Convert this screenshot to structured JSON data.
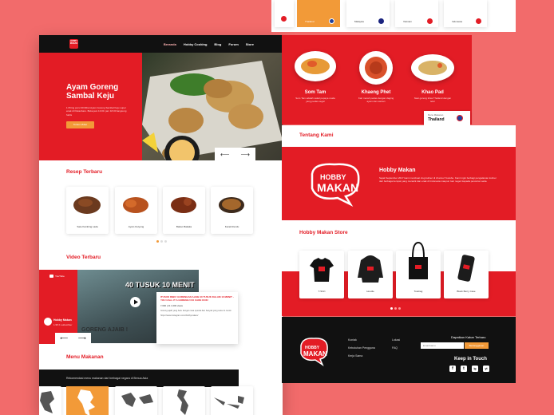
{
  "nav": {
    "logo": "HOBBY MAKAN",
    "links": [
      "Beranda",
      "Hobby Cooking",
      "Blog",
      "Forum",
      "Store"
    ]
  },
  "hero": {
    "title": "Ayam Goreng Sambal Keju",
    "description": "1 Piring porsi 30 Ribut Ayam Goreng Sambal Keju super enak di Pekanbaru. Buka jam 10.00. jam 18.00 langsung habis",
    "button": "Tonton Video",
    "prev": "⟵",
    "next": "⟶"
  },
  "recipes": {
    "title": "Resep Terbaru",
    "items": [
      {
        "name": "Sate Kambing Lada",
        "color": "#6b3a1f"
      },
      {
        "name": "Ayam Ketyung",
        "color": "#b8521e"
      },
      {
        "name": "Bakso Bakaka",
        "color": "#7a2e14"
      },
      {
        "name": "Kerak Rendu",
        "color": "#a4672c"
      }
    ]
  },
  "video": {
    "title": "Video Terbaru",
    "youtube_label": "YouTube",
    "channel_name": "Hobby Makan",
    "subscribers": "1.95 K subscriber",
    "overlay_top": "40 TUSUK 10 MENIT",
    "overlay_bottom": "GORENG AJAIB !",
    "headline": "ITUSUK RIBU! GORENGAN AJAIB 40 TUSUK DALAM 10 MENIT - YOU CALL IT A GORENG! KO CARE KOK!",
    "views": "7,600 | 21 1.000 views",
    "body": "Goreng ajaib yang baru dengan rasa special dan banyak yang suka ini cocok.",
    "link": "https://www.instagram.com/hobbymakan/",
    "prev": "⟵",
    "next": "⟶"
  },
  "menu": {
    "title": "Menu Makanan",
    "subtitle": "Rekomendasi menu makanan dari berbagai negara di Benua Asia"
  },
  "countries": {
    "items": [
      {
        "name": "Thailand",
        "active": true
      },
      {
        "name": "Malaysia",
        "active": false
      },
      {
        "name": "Vietnam",
        "active": false
      },
      {
        "name": "Indonesia",
        "active": false
      }
    ]
  },
  "dishes": {
    "items": [
      {
        "name": "Som Tam",
        "desc": "Som Tam adalah salad pepaya muda yang pedas segar",
        "color": "#e79a37"
      },
      {
        "name": "Khaeng Phet",
        "desc": "Kari merah pedas dengan daging ayam dan santan",
        "color": "#d9502a"
      },
      {
        "name": "Khao Pad",
        "desc": "Nasi goreng khas Thailand dengan telur",
        "color": "#d9b367"
      }
    ],
    "country_label": "Menu Makanan",
    "country": "Thailand"
  },
  "about": {
    "title": "Tentang Kami",
    "heading": "Hobby Makan",
    "text": "Sejak September 2017 kami membuat vlog kuliner di channel Youtube. Kami ingin berbagi pengalaman kuliner dari berbagai tempat yang menarik dan enak di Indonesia maupun luar negeri kepada penonton setia."
  },
  "store": {
    "title": "Hobby Makan Store",
    "items": [
      {
        "name": "T-Shirt"
      },
      {
        "name": "Hoodie"
      },
      {
        "name": "Totebag"
      },
      {
        "name": "Black Berry Case"
      }
    ]
  },
  "footer": {
    "col1": [
      "Kontak",
      "Kebutuhan Pengguna",
      "Kerja Sama"
    ],
    "col2": [
      "Lokasi",
      "FAQ"
    ],
    "newsletter_label": "Dapatkan Kabar Terbaru",
    "email_placeholder": "Email kamu",
    "subscribe_button": "Berlangganan",
    "keep_in_touch": "Keep in Touch",
    "social": [
      "f",
      "t",
      "ig",
      "yt"
    ]
  },
  "colors": {
    "brand_red": "#e31c25",
    "accent_orange": "#f29a38",
    "dark": "#111111",
    "background": "#f26b6b"
  }
}
